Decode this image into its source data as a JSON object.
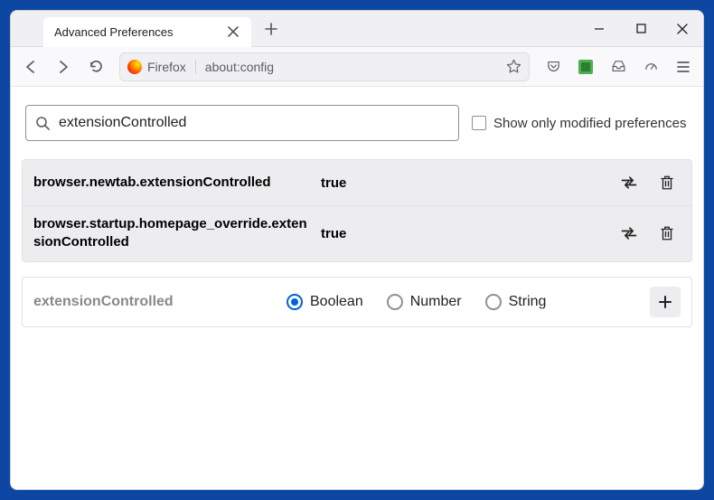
{
  "window": {
    "tab_title": "Advanced Preferences"
  },
  "toolbar": {
    "identity_label": "Firefox",
    "url": "about:config"
  },
  "search": {
    "value": "extensionControlled",
    "checkbox_label": "Show only modified preferences"
  },
  "prefs": [
    {
      "name": "browser.newtab.extensionControlled",
      "value": "true"
    },
    {
      "name": "browser.startup.homepage_override.extensionControlled",
      "value": "true"
    }
  ],
  "add": {
    "name": "extensionControlled",
    "options": [
      "Boolean",
      "Number",
      "String"
    ],
    "selected": "Boolean"
  }
}
